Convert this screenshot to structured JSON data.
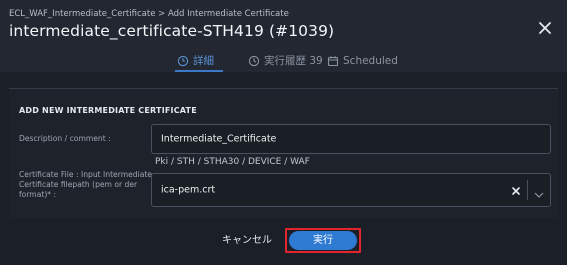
{
  "header": {
    "breadcrumb": "ECL_WAF_Intermediate_Certificate > Add Intermediate Certificate",
    "title": "intermediate_certificate-STH419 (#1039)"
  },
  "tabs": [
    {
      "label": "詳細",
      "icon": "clock-icon",
      "active": true
    },
    {
      "label": "実行履歴 39",
      "icon": "history-icon",
      "active": false
    },
    {
      "label": "Scheduled",
      "icon": "calendar-icon",
      "active": false
    }
  ],
  "form": {
    "section_title": "ADD NEW INTERMEDIATE CERTIFICATE",
    "description": {
      "label": "Description / comment :",
      "value": "Intermediate_Certificate"
    },
    "certificate": {
      "hint": "Pki / STH / STHA30 / DEVICE / WAF",
      "label_line1": "Certificate File : Input Intermediate",
      "label_line2": "Certificate filepath (pem or der",
      "label_line3": "format)* :",
      "value": "ica-pem.crt"
    }
  },
  "actions": {
    "cancel_label": "キャンセル",
    "run_label": "実行",
    "run_highlight_color": "#e0262c",
    "run_color": "#2f7bd3"
  },
  "colors": {
    "background": "#1b1f27",
    "header": "#222731",
    "active_tab": "#5b93d6"
  }
}
